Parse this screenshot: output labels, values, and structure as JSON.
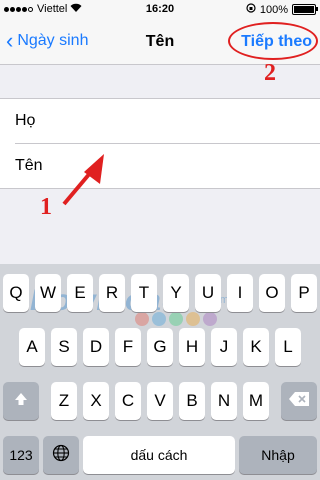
{
  "status": {
    "carrier": "Viettel",
    "time": "16:20",
    "battery": "100%",
    "battery_level": 1.0
  },
  "nav": {
    "back_label": "Ngày sinh",
    "title": "Tên",
    "next_label": "Tiếp theo"
  },
  "annotations": {
    "one": "1",
    "two": "2"
  },
  "form": {
    "last_name_placeholder": "Họ",
    "first_name_placeholder": "Tên"
  },
  "keyboard": {
    "row1": [
      "Q",
      "W",
      "E",
      "R",
      "T",
      "Y",
      "U",
      "I",
      "O",
      "P"
    ],
    "row2": [
      "A",
      "S",
      "D",
      "F",
      "G",
      "H",
      "J",
      "K",
      "L"
    ],
    "row3": [
      "Z",
      "X",
      "C",
      "V",
      "B",
      "N",
      "M"
    ],
    "numbers_label": "123",
    "space_label": "dấu cách",
    "return_label": "Nhập"
  },
  "watermark": {
    "text": "Download",
    "sub": ".com.vn",
    "colors": [
      "#e74c3c",
      "#3498db",
      "#2ecc71",
      "#f39c12",
      "#9b59b6"
    ]
  }
}
